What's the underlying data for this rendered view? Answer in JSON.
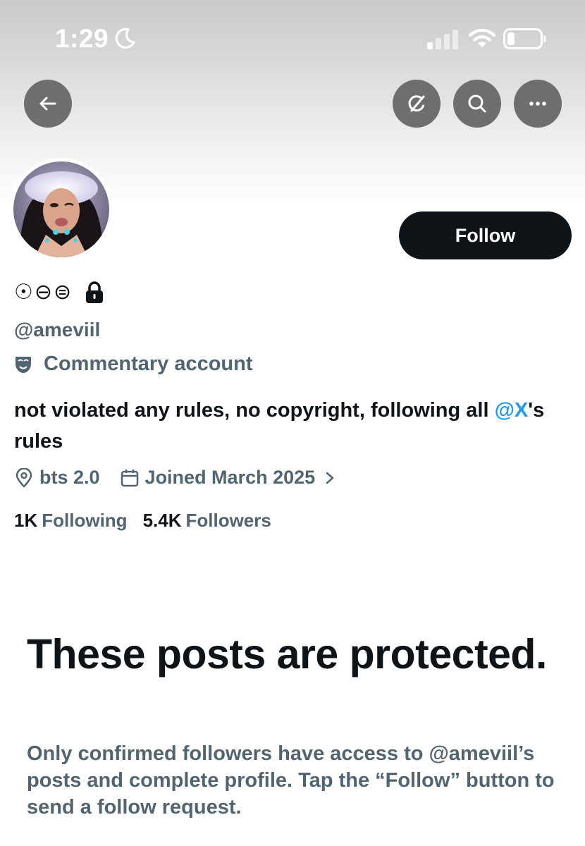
{
  "status_bar": {
    "time": "1:29",
    "icons": [
      "moon-icon",
      "cellular-signal-icon",
      "wifi-icon",
      "battery-icon"
    ]
  },
  "nav": {
    "buttons": [
      "back-arrow-icon",
      "grok-icon",
      "search-icon",
      "more-icon"
    ]
  },
  "profile": {
    "display_name": "☉⊖⊜",
    "protected_icon": "lock-icon",
    "handle": "@ameviil",
    "label_icon": "theater-mask-icon",
    "label": "Commentary account",
    "bio_text": "not violated any rules, no copyright, following all ",
    "bio_mention": "@X",
    "bio_suffix": "'s rules",
    "location_icon": "location-pin-icon",
    "location": "bts 2.0",
    "joined_icon": "calendar-icon",
    "joined": "Joined March 2025",
    "following_count": "1K",
    "following_label": "Following",
    "followers_count": "5.4K",
    "followers_label": "Followers"
  },
  "follow_button": {
    "label": "Follow"
  },
  "protected_notice": {
    "title": "These posts are protected.",
    "body": "Only confirmed followers have access to @ameviil’s posts and complete profile. Tap the “Follow” button to send a follow request."
  },
  "colors": {
    "primary_text": "#0f1419",
    "secondary_text": "#536471",
    "link": "#1d9bf0",
    "button_dark": "#0f1419",
    "nav_button_bg": "#6e6e6e"
  }
}
